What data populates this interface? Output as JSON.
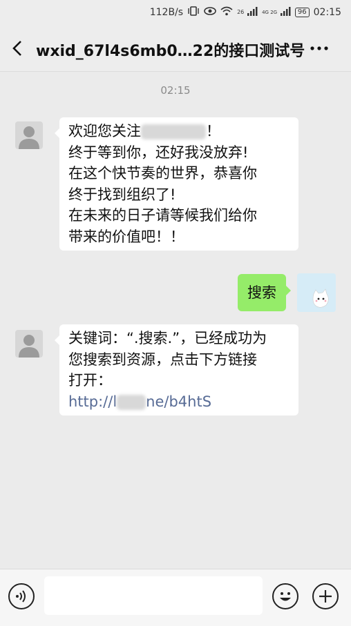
{
  "status_bar": {
    "speed": "112B/s",
    "network_1": "26",
    "network_2": "4G 2G",
    "battery": "96",
    "time": "02:15"
  },
  "header": {
    "title": "wxid_67l4s6mb0…22的接口测试号",
    "back_icon": "chevron-left-icon",
    "more_icon": "more-dots-icon"
  },
  "chat": {
    "timestamp": "02:15",
    "messages": [
      {
        "direction": "in",
        "lines": [
          "欢迎您关注",
          "！",
          "终于等到你，还好我没放弃!",
          "在这个快节奏的世界，恭喜你",
          "终于找到组织了!",
          "在未来的日子请等候我们给你",
          "带来的价值吧！！"
        ]
      },
      {
        "direction": "out",
        "text": "搜索"
      },
      {
        "direction": "in",
        "lines": [
          "关键词：“.搜索.”，已经成功为",
          "您搜索到资源，点击下方链接",
          "打开："
        ],
        "link_start": "http://l",
        "link_end": "ne/b4htS"
      }
    ]
  },
  "input_bar": {
    "voice_icon": "voice-icon",
    "emoji_icon": "emoji-icon",
    "plus_icon": "plus-icon",
    "value": ""
  },
  "colors": {
    "background": "#ebebeb",
    "out_bubble": "#95ec69",
    "link": "#576b95"
  }
}
